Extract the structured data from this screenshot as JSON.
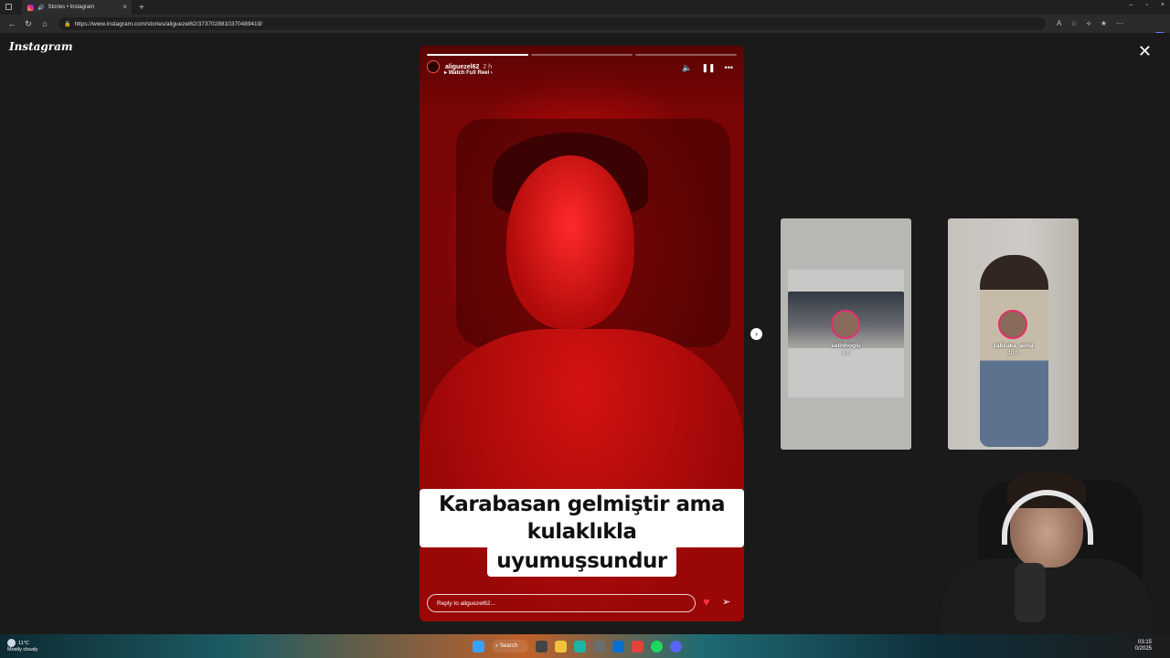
{
  "browser": {
    "tab_title": "Stories • Instagram",
    "tab_close": "×",
    "new_tab": "+",
    "url": "https://www.instagram.com/stories/aliguezel62/3737028810370489419/",
    "window_buttons": [
      "–",
      "▫",
      "×"
    ]
  },
  "page": {
    "logo": "Instagram",
    "close_label": "✕"
  },
  "story": {
    "username": "aliguezel62",
    "time": "2 h",
    "watch_reel": "Watch Full Reel",
    "caption_line1": "Karabasan gelmiştir ama kulaklıkla",
    "caption_line2": "uyumuşsundur",
    "reply_placeholder": "Reply to aliguezel62...",
    "progress": [
      1.0,
      0.0,
      0.0
    ]
  },
  "previews": [
    {
      "username": "selinhoglu",
      "time": "8 h"
    },
    {
      "username": "zabiiaka_alina",
      "time": "10 h"
    }
  ],
  "taskbar": {
    "temp": "11°C",
    "weather": "Mostly cloudy",
    "search_label": "Search",
    "time": "03:15",
    "date": "0/2025"
  },
  "colors": {
    "story_red": "#c20e0e",
    "heart": "#ff3040",
    "background": "#1a1a1a"
  }
}
